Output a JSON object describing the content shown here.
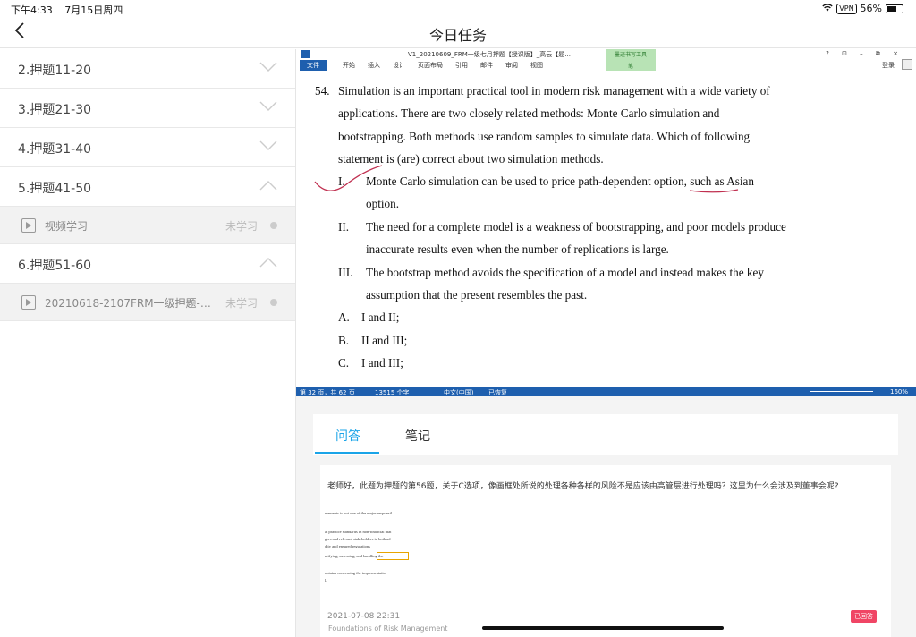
{
  "status_bar": {
    "time": "下午4:33",
    "date": "7月15日周四",
    "vpn": "VPN",
    "battery": "56%"
  },
  "header": {
    "title": "今日任务"
  },
  "sidebar": {
    "chapters": [
      {
        "label": "2.押题11-20"
      },
      {
        "label": "3.押题21-30"
      },
      {
        "label": "4.押题31-40"
      },
      {
        "label": "5.押题41-50",
        "lesson": {
          "title": "视频学习",
          "status": "未学习"
        }
      },
      {
        "label": "6.押题51-60",
        "lesson": {
          "title": "20210618-2107FRM一级押题-高...",
          "status": "未学习"
        }
      }
    ]
  },
  "word": {
    "title": "V1_20210609_FRM一级七月押题【授课版】_高云【题...",
    "window_controls": "? ⊡ – ⧉ ×",
    "file_tab": "文件",
    "tabs": [
      "开始",
      "插入",
      "设计",
      "页面布局",
      "引用",
      "邮件",
      "审阅",
      "视图"
    ],
    "context_tab": {
      "line1": "墨迹书写工具",
      "line2": "笔"
    },
    "login": "登录",
    "status": {
      "page": "第 32 页，共 62 页",
      "words": "13515 个字",
      "lang": "中文(中国)",
      "recovered": "已恢复",
      "zoom": "160%"
    }
  },
  "question": {
    "number": "54.",
    "stem": [
      "Simulation is an important practical tool in modern risk management with a wide variety of",
      "applications. There are two closely related methods: Monte Carlo simulation and",
      "bootstrapping. Both methods use random samples to simulate data. Which of following",
      "statement is (are) correct about two simulation methods."
    ],
    "statements": [
      {
        "num": "I.",
        "lines": [
          "Monte Carlo simulation can be used to price path-dependent option, such as Asian",
          "option."
        ]
      },
      {
        "num": "II.",
        "lines": [
          "The need for a complete model is a weakness of bootstrapping, and poor models produce",
          "inaccurate results even when the number of replications is large."
        ]
      },
      {
        "num": "III.",
        "lines": [
          "The bootstrap method avoids the specification of a model and instead makes the key",
          "assumption that the present resembles the past."
        ]
      }
    ],
    "choices": [
      {
        "letter": "A.",
        "text": "I and II;"
      },
      {
        "letter": "B.",
        "text": "II and III;"
      },
      {
        "letter": "C.",
        "text": "I and III;"
      }
    ]
  },
  "qa": {
    "tabs": [
      "问答",
      "笔记"
    ],
    "post": {
      "text": "老师好，此题为押题的第56题，关于C选项，像画框处所说的处理各种各样的风险不是应该由高管层进行处理吗？这里为什么会涉及到董事会呢?",
      "image_lines": [
        "elements is not one of the major responsil",
        "at practice standards in non-financial mat",
        "gers and relevant stakeholders in both ad",
        "dity and ensured regulations",
        "ntifying, assessing, and handling the",
        " obtains concerning the implementatio",
        "l."
      ],
      "timestamp": "2021-07-08 22:31",
      "badge": "已回答",
      "footer": "Foundations of Risk Management"
    }
  }
}
